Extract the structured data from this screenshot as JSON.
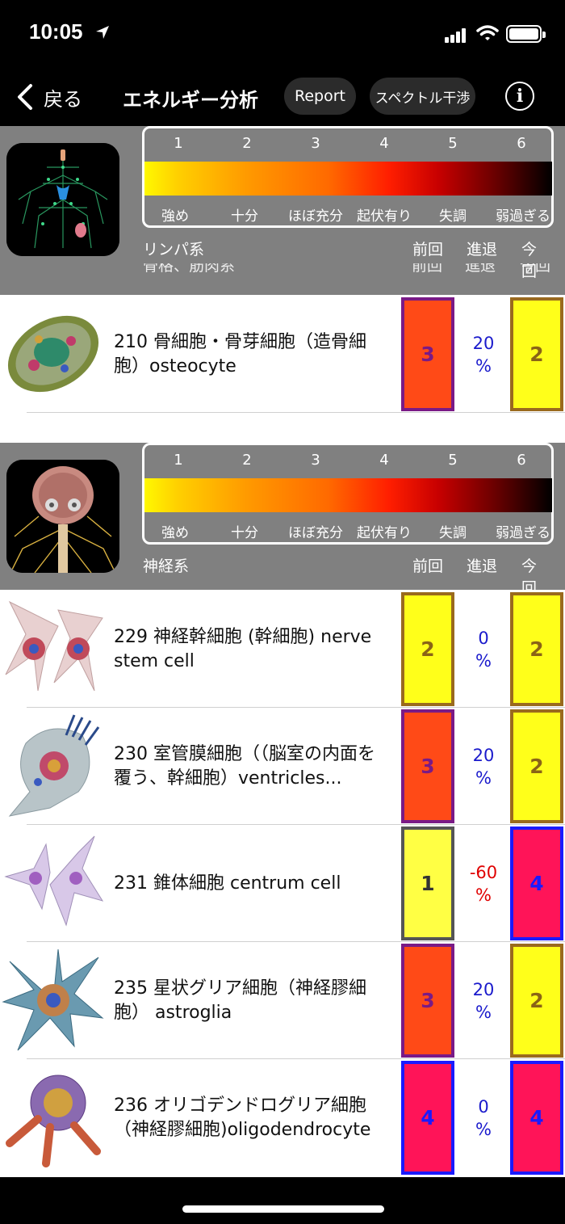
{
  "status": {
    "time": "10:05"
  },
  "nav": {
    "back_label": "戻る",
    "title": "エネルギー分析",
    "report_label": "Report",
    "spectrum_label": "スペクトル干渉",
    "info_label": "i"
  },
  "scale": {
    "numbers": [
      "1",
      "2",
      "3",
      "4",
      "5",
      "6"
    ],
    "words": [
      "強め",
      "十分",
      "ほぼ充分",
      "起伏有り",
      "失調",
      "弱過ぎる"
    ]
  },
  "columns": {
    "prev": "前回",
    "progress": "進退",
    "current": "今回"
  },
  "sections": [
    {
      "name": "リンパ系",
      "hidden_name": "骨格、筋肉系"
    },
    {
      "name": "神経系"
    }
  ],
  "rows": [
    {
      "name": "210 骨細胞・骨芽細胞（造骨細胞）osteocyte",
      "prev": "3",
      "pct_value": "20",
      "pct_sign": "%",
      "cur": "2"
    },
    {
      "name": "229 神経幹細胞 (幹細胞) nerve stem cell",
      "prev": "2",
      "pct_value": "0",
      "pct_sign": "%",
      "cur": "2"
    },
    {
      "name": "230 室管膜細胞（（脳室の内面を覆う、幹細胞）ventricles...",
      "prev": "3",
      "pct_value": "20",
      "pct_sign": "%",
      "cur": "2"
    },
    {
      "name": "231 錐体細胞 centrum cell",
      "prev": "1",
      "pct_value": "-60",
      "pct_sign": "%",
      "cur": "4"
    },
    {
      "name": "235 星状グリア細胞（神経膠細胞） astroglia",
      "prev": "3",
      "pct_value": "20",
      "pct_sign": "%",
      "cur": "2"
    },
    {
      "name": "236 オリゴデンドログリア細胞（神経膠細胞)oligodendrocyte",
      "prev": "4",
      "pct_value": "0",
      "pct_sign": "%",
      "cur": "4"
    }
  ],
  "colors": {
    "level_1": "#ffff44",
    "level_1_border": "#555555",
    "level_2": "#ffff1a",
    "level_2_border": "#9a6a1e",
    "level_3": "#ff4a17",
    "level_3_border": "#7a1a86",
    "level_4": "#ff1458",
    "level_4_border": "#1a1aff",
    "text_2": "#8a6416",
    "text_3": "#7a1a86",
    "text_4": "#1a1aff",
    "text_1": "#333333",
    "pct_positive": "#1a1acc",
    "pct_negative": "#e00000"
  }
}
